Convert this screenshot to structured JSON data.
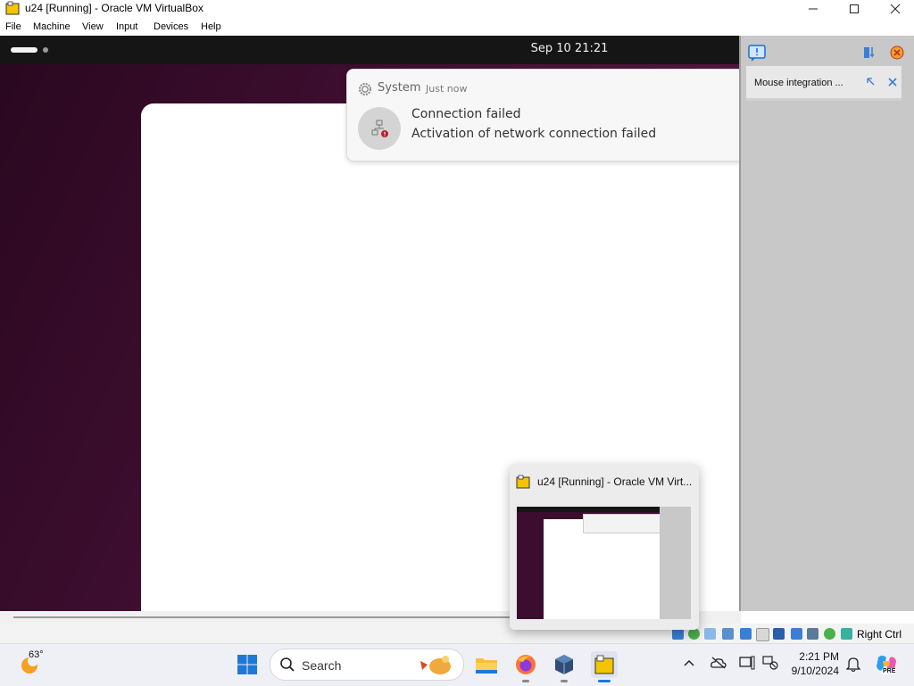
{
  "window": {
    "title": "u24 [Running] - Oracle VM VirtualBox",
    "controls": [
      "minimize",
      "maximize",
      "close"
    ]
  },
  "menubar": {
    "items": [
      "File",
      "Machine",
      "View",
      "Input",
      "Devices",
      "Help"
    ]
  },
  "guest": {
    "top_bar": {
      "clock": "Sep 10  21:21"
    },
    "notification": {
      "source": "System",
      "time": "Just now",
      "summary": "Connection failed",
      "body": "Activation of network connection failed",
      "icon": "network-error-icon"
    }
  },
  "vbox_notification_center": {
    "item_text": "Mouse integration ..."
  },
  "statusbar": {
    "host_key": "Right Ctrl",
    "icons": [
      "hard-disk-icon",
      "optical-drive-icon",
      "audio-icon",
      "network-icon",
      "usb-icon",
      "shared-folders-icon",
      "display-icon",
      "recording-icon",
      "cpu-icon",
      "mouse-integration-icon",
      "keyboard-icon"
    ]
  },
  "taskbar_preview": {
    "title": "u24 [Running] - Oracle VM Virt..."
  },
  "taskbar": {
    "weather_temp": "63°",
    "search_placeholder": "Search",
    "time": "2:21 PM",
    "date": "9/10/2024",
    "copilot_badge": "PRE"
  },
  "colors": {
    "guest_bg": "#3c0d2e",
    "gnome_bar": "#151515",
    "error_red": "#c01c28",
    "taskbar_bg": "#eef0f5"
  }
}
